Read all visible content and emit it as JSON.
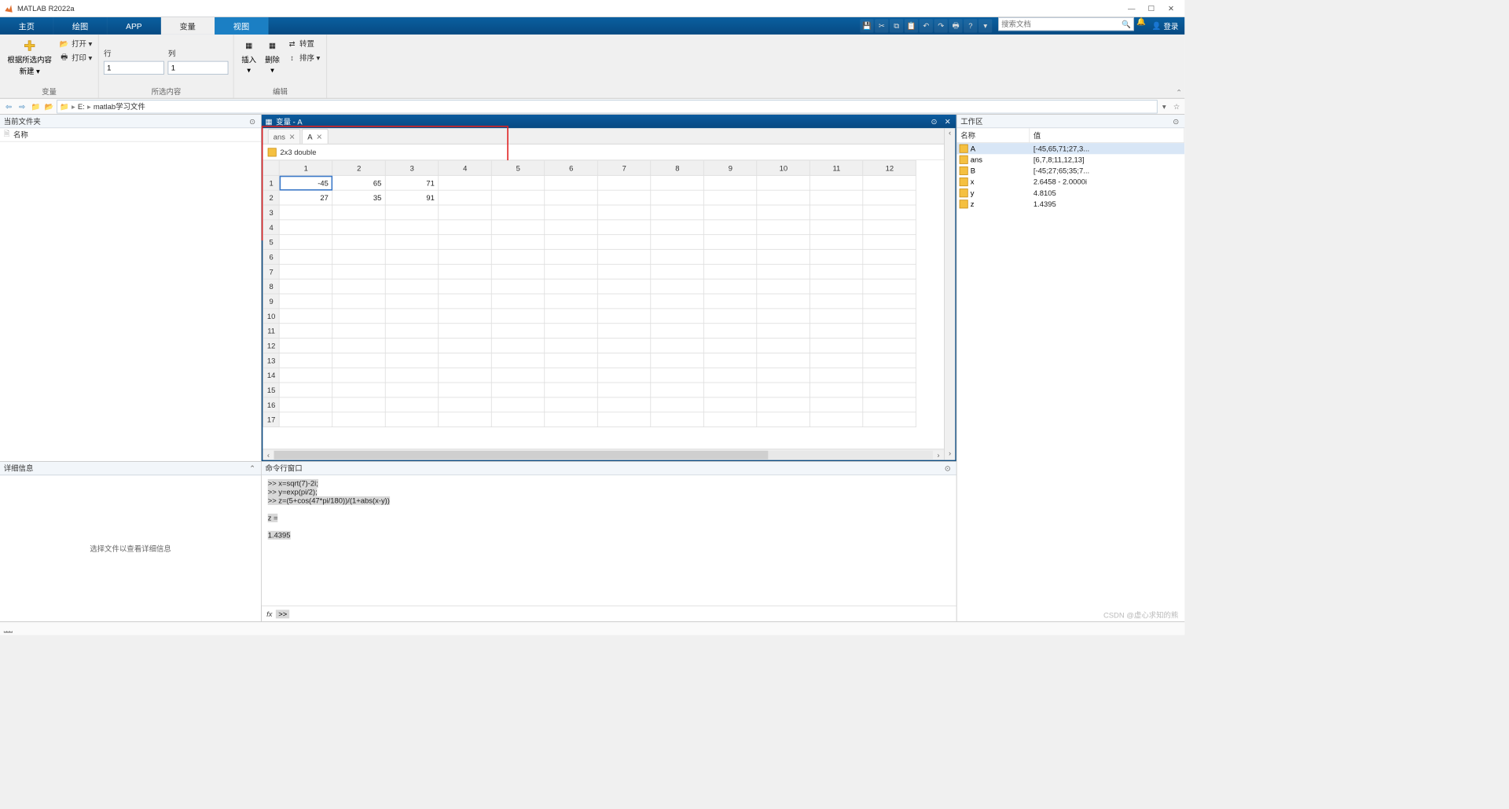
{
  "title": "MATLAB R2022a",
  "ribbon_tabs": {
    "home": "主页",
    "plot": "绘图",
    "app": "APP",
    "var": "变量",
    "view": "视图"
  },
  "qat": {
    "search_placeholder": "搜索文档",
    "login": "登录"
  },
  "ribbon": {
    "g1": {
      "new": "根据所选内容",
      "new2": "新建 ▾",
      "open": "打开 ▾",
      "print": "打印 ▾",
      "label": "变量"
    },
    "g2": {
      "row": "行",
      "col": "列",
      "row_val": "1",
      "col_val": "1",
      "label": "所选内容"
    },
    "g3": {
      "insert": "插入",
      "delete": "删除",
      "transpose": "转置",
      "sort": "排序 ▾",
      "label": "编辑"
    }
  },
  "path": {
    "drive": "E:",
    "folder": "matlab学习文件"
  },
  "panes": {
    "current_folder": "当前文件夹",
    "name_col": "名称",
    "details": "详细信息",
    "details_msg": "选择文件以查看详细信息",
    "var_title": "变量 - A",
    "cmd_title": "命令行窗口",
    "workspace": "工作区",
    "ws_name": "名称",
    "ws_value": "值"
  },
  "var_tabs": {
    "ans": "ans",
    "A": "A"
  },
  "var_type": "2x3 double",
  "grid": {
    "cols": [
      "1",
      "2",
      "3",
      "4",
      "5",
      "6",
      "7",
      "8",
      "9",
      "10",
      "11",
      "12"
    ],
    "rows": [
      "1",
      "2",
      "3",
      "4",
      "5",
      "6",
      "7",
      "8",
      "9",
      "10",
      "11",
      "12",
      "13",
      "14",
      "15",
      "16",
      "17"
    ],
    "data": [
      [
        "-45",
        "65",
        "71"
      ],
      [
        "27",
        "35",
        "91"
      ]
    ]
  },
  "cmd": {
    "l1": ">> x=sqrt(7)-2i;",
    "l2": ">> y=exp(pi/2);",
    "l3": ">> z=(5+cos(47*pi/180))/(1+abs(x-y))",
    "l4": "z =",
    "l5": "    1.4395",
    "prompt": ">>"
  },
  "workspace": [
    {
      "name": "A",
      "value": "[-45,65,71;27,3..."
    },
    {
      "name": "ans",
      "value": "[6,7,8;11,12,13]"
    },
    {
      "name": "B",
      "value": "[-45;27;65;35;7..."
    },
    {
      "name": "x",
      "value": "2.6458 - 2.0000i"
    },
    {
      "name": "y",
      "value": "4.8105"
    },
    {
      "name": "z",
      "value": "1.4395"
    }
  ],
  "watermark": "CSDN @虚心求知的熊"
}
